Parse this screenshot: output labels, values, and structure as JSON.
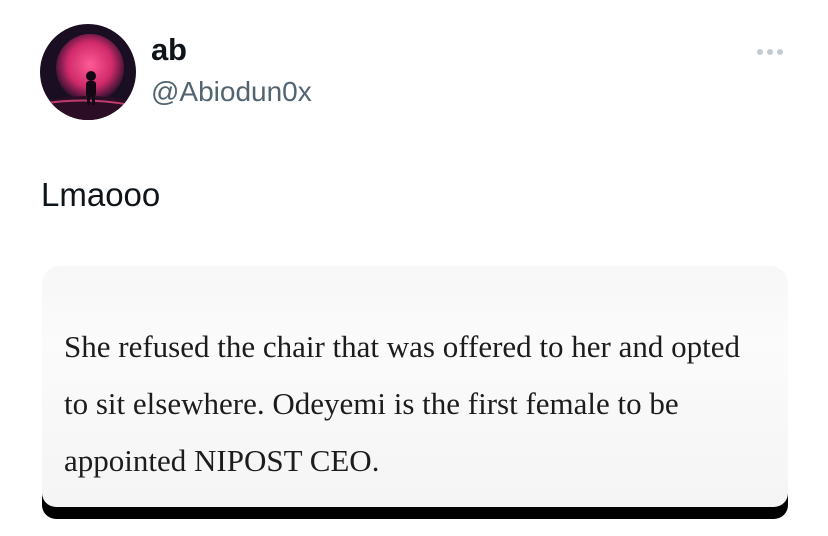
{
  "author": {
    "display_name": "ab",
    "handle": "@Abiodun0x"
  },
  "tweet": {
    "text": "Lmaooo"
  },
  "media": {
    "quote_text": "She refused the chair that was offered to her and opted to sit elsewhere. Odeyemi is the first female to be appointed NIPOST CEO."
  },
  "icons": {
    "more": "more-options-icon"
  },
  "colors": {
    "text": "#0f1419",
    "secondary": "#536471",
    "avatar_accent": "#e2407a",
    "avatar_bg": "#1a0f22"
  }
}
